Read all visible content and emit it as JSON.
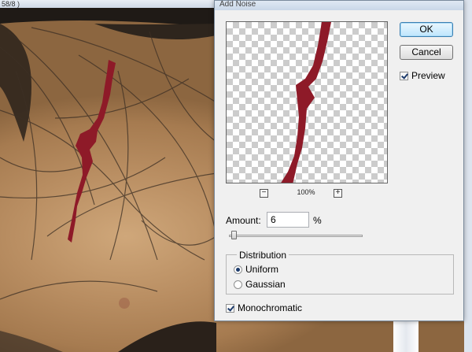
{
  "document": {
    "title_fragment": "58/8 )"
  },
  "dialog": {
    "title": "Add Noise",
    "ok_label": "OK",
    "cancel_label": "Cancel",
    "preview_label": "Preview",
    "preview_checked": true,
    "zoom_out_glyph": "−",
    "zoom_in_glyph": "+",
    "zoom_level": "100%",
    "amount_label": "Amount:",
    "amount_value": "6",
    "amount_unit": "%",
    "amount_fraction": 0.015,
    "distribution": {
      "label": "Distribution",
      "options": [
        {
          "label": "Uniform",
          "selected": true
        },
        {
          "label": "Gaussian",
          "selected": false
        }
      ]
    },
    "monochromatic_label": "Monochromatic",
    "monochromatic_checked": true
  },
  "colors": {
    "stroke_red": "#8e1a28",
    "dialog_bg": "#f0f0f0"
  },
  "icons": [
    "zoom-out-icon",
    "zoom-in-icon",
    "check-icon",
    "radio-icon"
  ]
}
